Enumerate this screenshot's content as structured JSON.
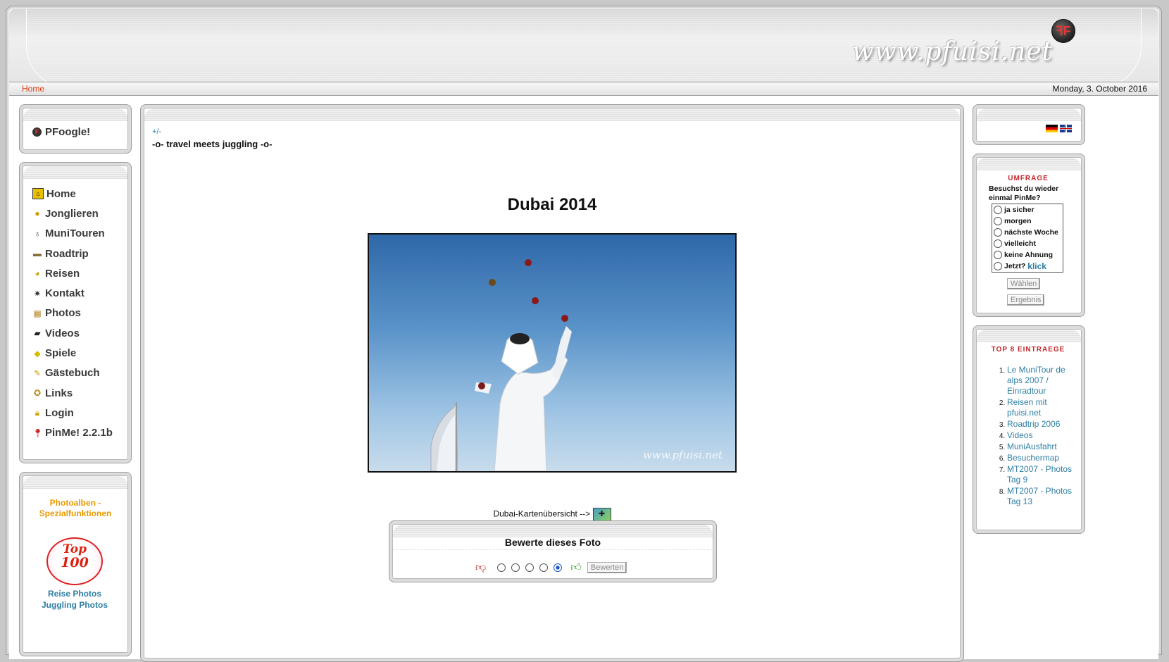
{
  "header": {
    "site_url": "www.pfuisi.net",
    "logo_letter": "ꟻF"
  },
  "navbar": {
    "home": "Home",
    "date": "Monday, 3. October 2016"
  },
  "left": {
    "pfoogle": "PFoogle!",
    "menu": [
      {
        "label": "Home",
        "icon": "home-icon"
      },
      {
        "label": "Jonglieren",
        "icon": "juggling-balls-icon"
      },
      {
        "label": "MuniTouren",
        "icon": "unicycle-icon"
      },
      {
        "label": "Roadtrip",
        "icon": "car-icon"
      },
      {
        "label": "Reisen",
        "icon": "globe-icon"
      },
      {
        "label": "Kontakt",
        "icon": "contact-star-icon"
      },
      {
        "label": "Photos",
        "icon": "photos-icon"
      },
      {
        "label": "Videos",
        "icon": "clapper-icon"
      },
      {
        "label": "Spiele",
        "icon": "dice-icon"
      },
      {
        "label": "Gästebuch",
        "icon": "guestbook-pen-icon"
      },
      {
        "label": "Links",
        "icon": "links-gear-icon"
      },
      {
        "label": "Login",
        "icon": "lock-icon"
      },
      {
        "label": "PinMe! 2.2.1b",
        "icon": "pin-icon"
      }
    ],
    "photoalben_title": "Photoalben - Spezialfunktionen",
    "top100_badge": {
      "line1": "Top",
      "line2": "100"
    },
    "top100_links": [
      "Reise Photos",
      "Juggling Photos"
    ]
  },
  "center": {
    "toggle": "+/-",
    "subtitle": "-o- travel meets juggling -o-",
    "title": "Dubai 2014",
    "photo_watermark": "www.pfuisi.net",
    "map_link_text": "Dubai-Kartenübersicht -->",
    "rating": {
      "title": "Bewerte dieses Foto",
      "button": "Bewerten",
      "selected": 5,
      "options": 5
    }
  },
  "right": {
    "languages": [
      "de-flag-icon",
      "gb-flag-icon"
    ],
    "poll": {
      "title": "UMFRAGE",
      "question": "Besuchst du wieder einmal PinMe?",
      "options": [
        "ja sicher",
        "morgen",
        "nächste Woche",
        "vielleicht",
        "keine Ahnung",
        "Jetzt?"
      ],
      "last_option_link": "klick",
      "vote_button": "Wählen",
      "result_button": "Ergebnis"
    },
    "top8": {
      "title": "TOP 8 EINTRAEGE",
      "items": [
        "Le MuniTour de alps 2007 / Einradtour",
        "Reisen mit pfuisi.net",
        "Roadtrip 2006",
        "Videos",
        "MuniAusfahrt",
        "Besuchermap",
        "MT2007 - Photos Tag 9",
        "MT2007 - Photos Tag 13"
      ]
    }
  },
  "colors": {
    "link_blue": "#2e7ea5",
    "accent_orange": "#e89a00",
    "nav_red": "#d64218",
    "poll_red": "#c2262c"
  }
}
